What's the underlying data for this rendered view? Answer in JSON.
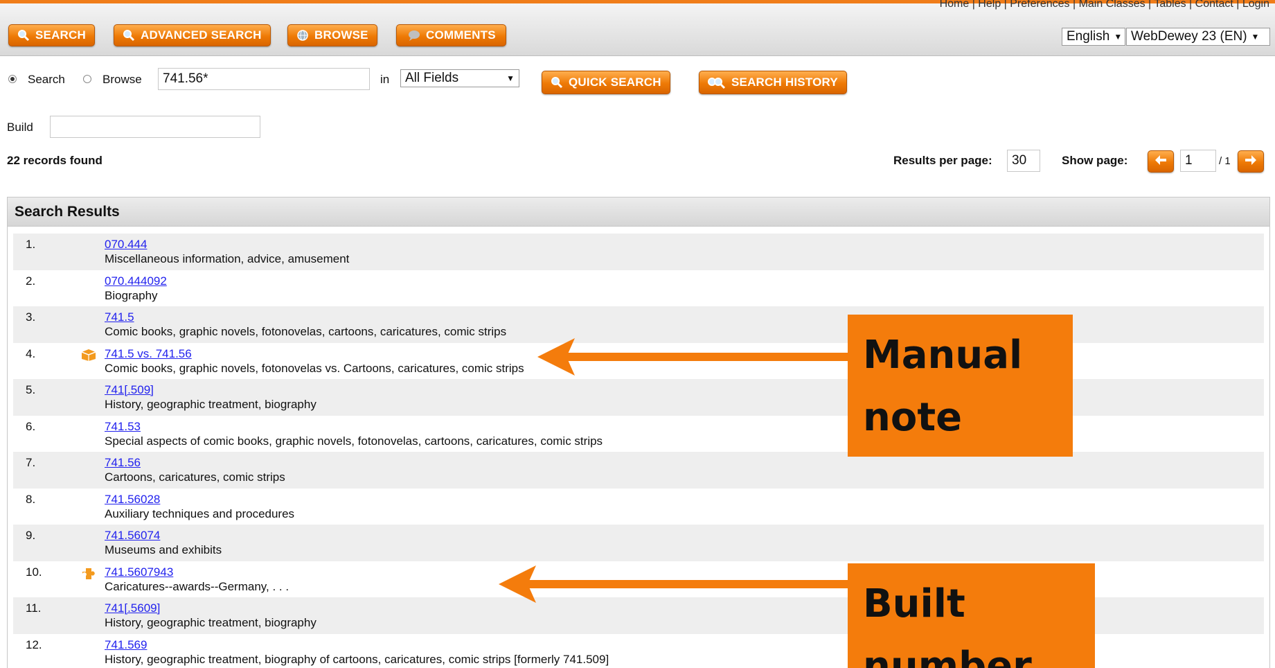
{
  "top_links": "Home | Help | Preferences | Main Classes | Tables | Contact | Login",
  "nav": {
    "buttons": [
      {
        "label": "SEARCH",
        "icon": "magnifier-icon"
      },
      {
        "label": "ADVANCED SEARCH",
        "icon": "magnifier-icon"
      },
      {
        "label": "BROWSE",
        "icon": "globe-icon"
      },
      {
        "label": "COMMENTS",
        "icon": "speech-bubble-icon"
      }
    ],
    "language": "English",
    "edition": "WebDewey 23 (EN)"
  },
  "search": {
    "mode_search": "Search",
    "mode_browse": "Browse",
    "selected_mode": "Search",
    "query": "741.56*",
    "in_label": "in",
    "field": "All Fields",
    "quick_search": "QUICK SEARCH",
    "search_history": "SEARCH HISTORY"
  },
  "build": {
    "label": "Build",
    "value": ""
  },
  "summary": {
    "records_found": "22 records found",
    "per_page_label": "Results per page:",
    "per_page": "30",
    "show_page_label": "Show page:",
    "current_page": "1",
    "total_pages": "/ 1"
  },
  "results": {
    "title": "Search Results",
    "items": [
      {
        "num": "1.",
        "code": "070.444",
        "desc": "Miscellaneous information, advice, amusement"
      },
      {
        "num": "2.",
        "code": "070.444092",
        "desc": "Biography"
      },
      {
        "num": "3.",
        "code": "741.5",
        "desc": "Comic books, graphic novels, fotonovelas, cartoons, caricatures, comic strips"
      },
      {
        "num": "4.",
        "code": "741.5 vs. 741.56",
        "desc": "Comic books, graphic novels, fotonovelas vs. Cartoons, caricatures, comic strips",
        "icon": "manual-note-icon"
      },
      {
        "num": "5.",
        "code": "741[.509]",
        "desc": "History, geographic treatment, biography"
      },
      {
        "num": "6.",
        "code": "741.53",
        "desc": "Special aspects of comic books, graphic novels, fotonovelas, cartoons, caricatures, comic strips"
      },
      {
        "num": "7.",
        "code": "741.56",
        "desc": "Cartoons, caricatures, comic strips"
      },
      {
        "num": "8.",
        "code": "741.56028",
        "desc": "Auxiliary techniques and procedures"
      },
      {
        "num": "9.",
        "code": "741.56074",
        "desc": "Museums and exhibits"
      },
      {
        "num": "10.",
        "code": "741.5607943",
        "desc": "Caricatures--awards--Germany, . . .",
        "icon": "built-number-icon"
      },
      {
        "num": "11.",
        "code": "741[.5609]",
        "desc": "History, geographic treatment, biography"
      },
      {
        "num": "12.",
        "code": "741.569",
        "desc": "History, geographic treatment, biography of cartoons, caricatures, comic strips [formerly 741.509]"
      }
    ]
  },
  "annotations": {
    "manual_note": "Manual note",
    "built_number": "Built number"
  },
  "colors": {
    "accent": "#f07d1a",
    "link": "#2222ee",
    "callout": "#f47c0c"
  }
}
